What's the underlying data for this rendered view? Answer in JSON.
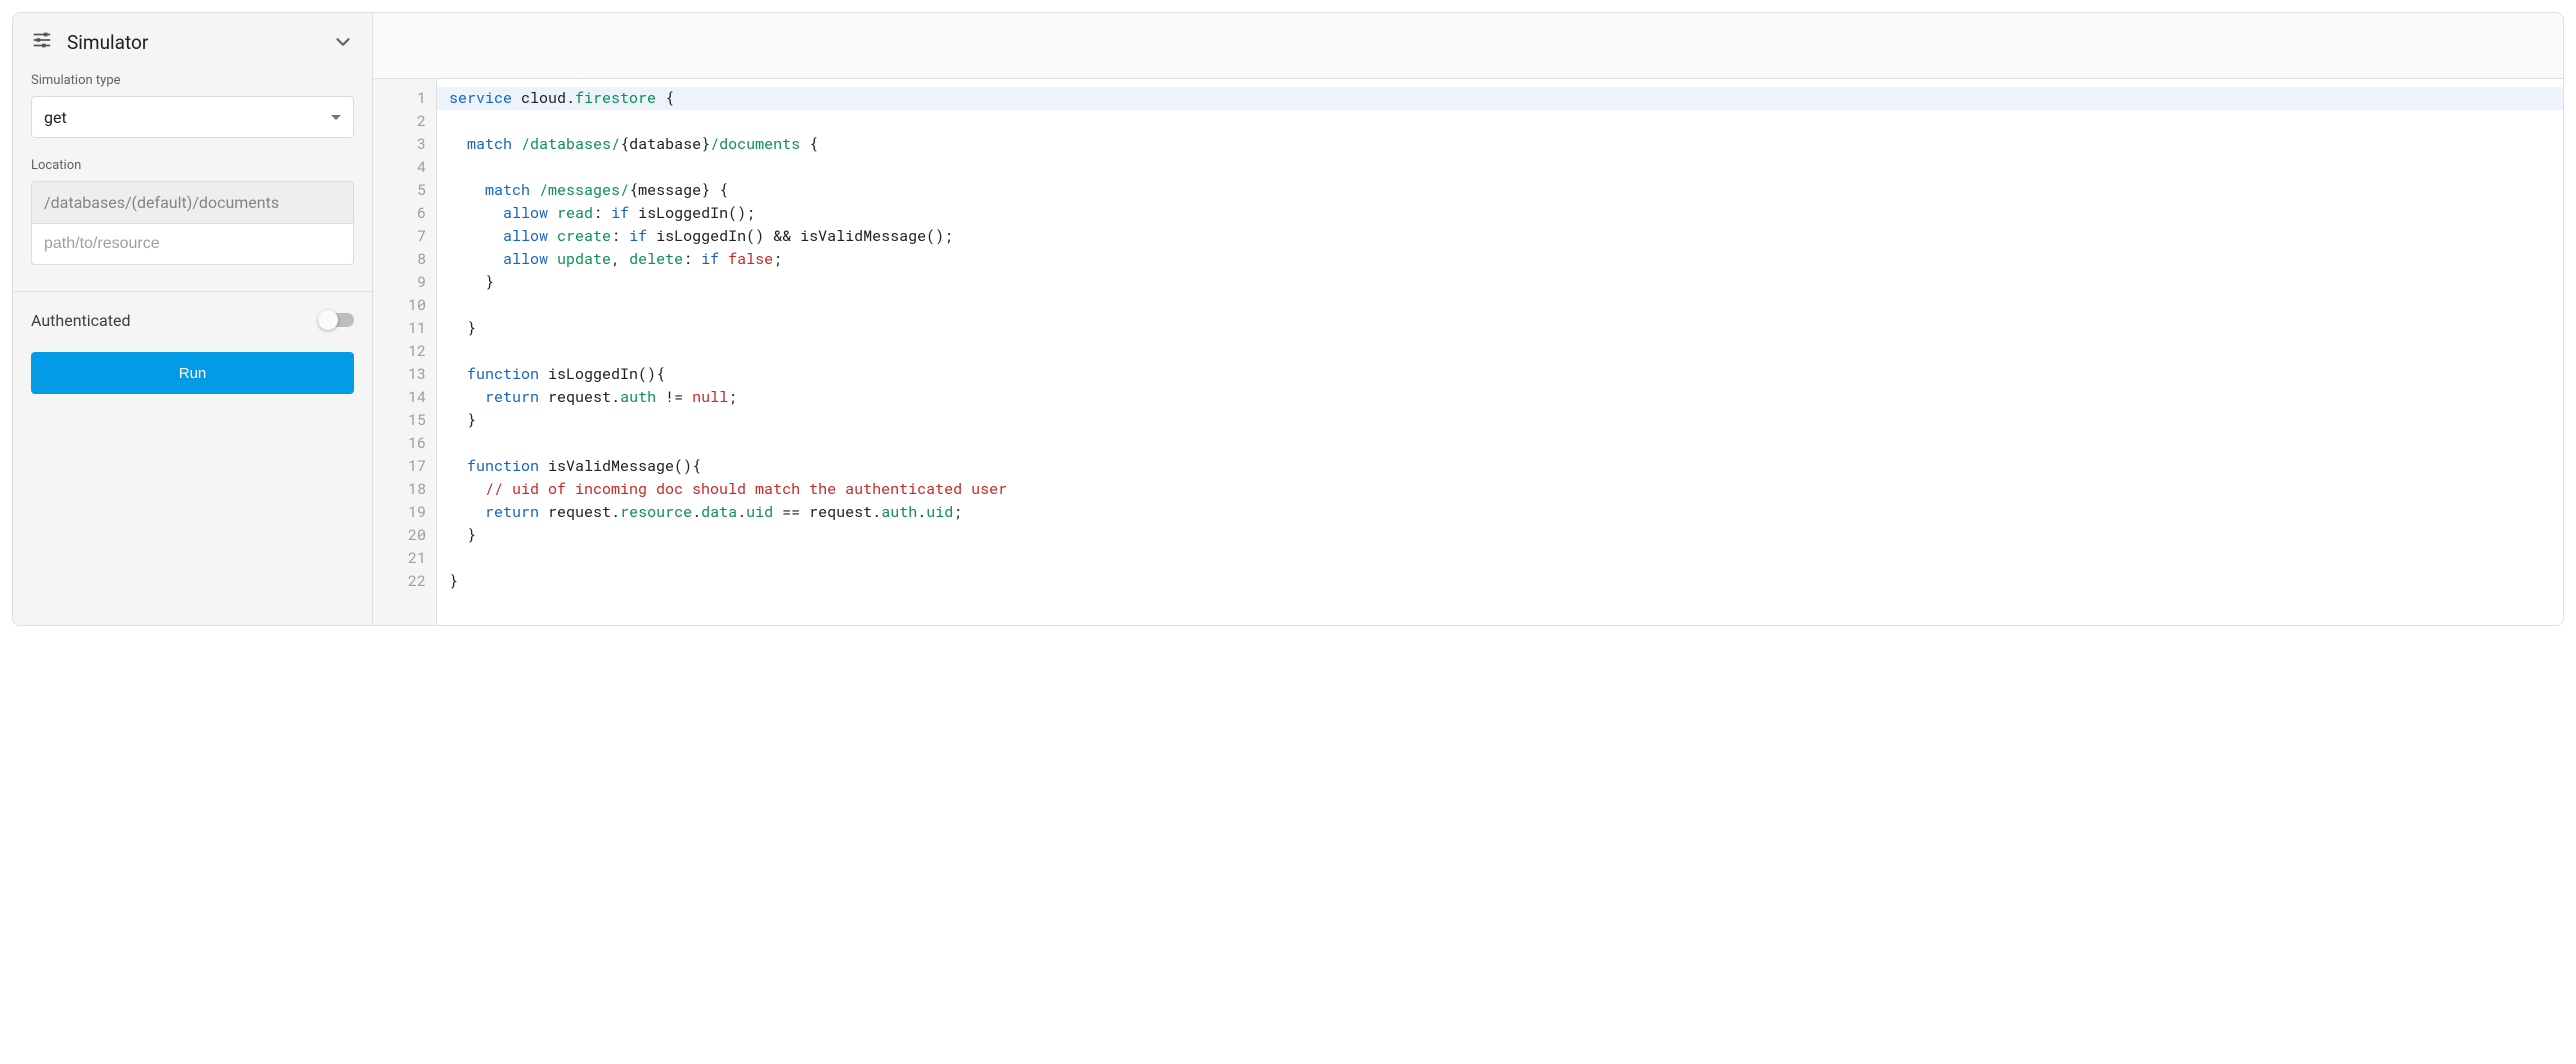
{
  "sidebar": {
    "title": "Simulator",
    "simTypeLabel": "Simulation type",
    "simTypeValue": "get",
    "locationLabel": "Location",
    "locationPrefix": "/databases/(default)/documents",
    "locationPlaceholder": "path/to/resource",
    "authLabel": "Authenticated",
    "authEnabled": false,
    "runLabel": "Run"
  },
  "editor": {
    "lineCount": 22,
    "lines": [
      [
        [
          "kw",
          "service"
        ],
        [
          "pl",
          " cloud"
        ],
        [
          "pl",
          "."
        ],
        [
          "str",
          "firestore"
        ],
        [
          "pl",
          " {"
        ]
      ],
      [],
      [
        [
          "pl",
          "  "
        ],
        [
          "kw",
          "match"
        ],
        [
          "pl",
          " "
        ],
        [
          "str",
          "/databases/"
        ],
        [
          "pl",
          "{database}"
        ],
        [
          "str",
          "/documents"
        ],
        [
          "pl",
          " {"
        ]
      ],
      [],
      [
        [
          "pl",
          "    "
        ],
        [
          "kw",
          "match"
        ],
        [
          "pl",
          " "
        ],
        [
          "str",
          "/messages/"
        ],
        [
          "pl",
          "{message} {"
        ]
      ],
      [
        [
          "pl",
          "      "
        ],
        [
          "kw",
          "allow"
        ],
        [
          "pl",
          " "
        ],
        [
          "str",
          "read"
        ],
        [
          "pl",
          ": "
        ],
        [
          "kw",
          "if"
        ],
        [
          "pl",
          " isLoggedIn();"
        ]
      ],
      [
        [
          "pl",
          "      "
        ],
        [
          "kw",
          "allow"
        ],
        [
          "pl",
          " "
        ],
        [
          "str",
          "create"
        ],
        [
          "pl",
          ": "
        ],
        [
          "kw",
          "if"
        ],
        [
          "pl",
          " isLoggedIn() && isValidMessage();"
        ]
      ],
      [
        [
          "pl",
          "      "
        ],
        [
          "kw",
          "allow"
        ],
        [
          "pl",
          " "
        ],
        [
          "str",
          "update"
        ],
        [
          "pl",
          ", "
        ],
        [
          "str",
          "delete"
        ],
        [
          "pl",
          ": "
        ],
        [
          "kw",
          "if"
        ],
        [
          "pl",
          " "
        ],
        [
          "lit",
          "false"
        ],
        [
          "pl",
          ";"
        ]
      ],
      [
        [
          "pl",
          "    }"
        ]
      ],
      [],
      [
        [
          "pl",
          "  }"
        ]
      ],
      [],
      [
        [
          "pl",
          "  "
        ],
        [
          "kw",
          "function"
        ],
        [
          "pl",
          " isLoggedIn(){"
        ]
      ],
      [
        [
          "pl",
          "    "
        ],
        [
          "kw",
          "return"
        ],
        [
          "pl",
          " request"
        ],
        [
          "pl",
          "."
        ],
        [
          "str",
          "auth"
        ],
        [
          "pl",
          " != "
        ],
        [
          "lit",
          "null"
        ],
        [
          "pl",
          ";"
        ]
      ],
      [
        [
          "pl",
          "  }"
        ]
      ],
      [],
      [
        [
          "pl",
          "  "
        ],
        [
          "kw",
          "function"
        ],
        [
          "pl",
          " isValidMessage(){"
        ]
      ],
      [
        [
          "pl",
          "    "
        ],
        [
          "cm",
          "// uid of incoming doc should match the authenticated user"
        ]
      ],
      [
        [
          "pl",
          "    "
        ],
        [
          "kw",
          "return"
        ],
        [
          "pl",
          " request"
        ],
        [
          "pl",
          "."
        ],
        [
          "str",
          "resource"
        ],
        [
          "pl",
          "."
        ],
        [
          "str",
          "data"
        ],
        [
          "pl",
          "."
        ],
        [
          "str",
          "uid"
        ],
        [
          "pl",
          " == request"
        ],
        [
          "pl",
          "."
        ],
        [
          "str",
          "auth"
        ],
        [
          "pl",
          "."
        ],
        [
          "str",
          "uid"
        ],
        [
          "pl",
          ";"
        ]
      ],
      [
        [
          "pl",
          "  }"
        ]
      ],
      [],
      [
        [
          "pl",
          "}"
        ]
      ]
    ],
    "highlightedLine": 1
  }
}
